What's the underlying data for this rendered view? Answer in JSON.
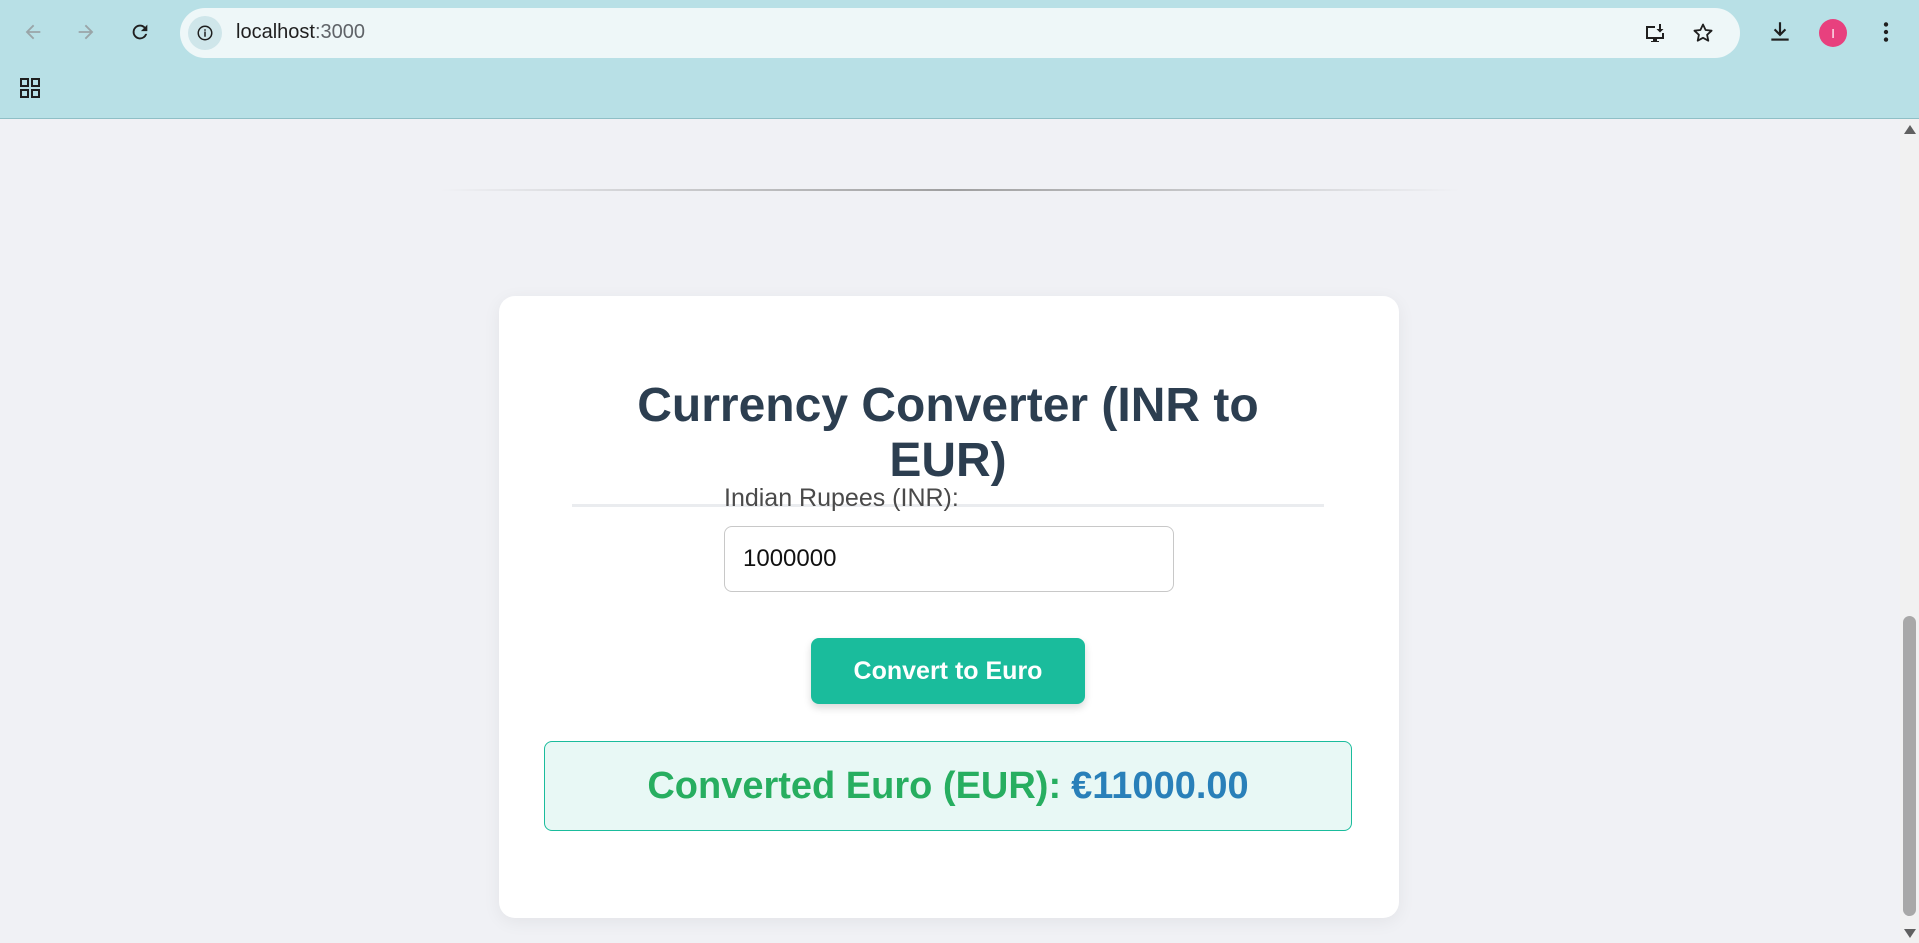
{
  "browser": {
    "url_host": "localhost",
    "url_port": ":3000",
    "icons": {
      "back": "arrow-left-icon",
      "forward": "arrow-right-icon",
      "reload": "reload-icon",
      "site_info": "info-icon",
      "install": "install-app-icon",
      "bookmark": "star-icon",
      "downloads": "download-icon",
      "menu": "kebab-menu-icon",
      "apps": "apps-grid-icon"
    },
    "profile_initial": "I",
    "colors": {
      "toolbar": "#b8e0e6",
      "avatar": "#e8407e"
    }
  },
  "page": {
    "title": "Currency Converter (INR to EUR)",
    "input_label": "Indian Rupees (INR):",
    "input_value": "1000000",
    "convert_button": "Convert to Euro",
    "result_label": "Converted Euro (EUR):",
    "result_value": "€11000.00",
    "colors": {
      "button": "#1abc9c",
      "result_label": "#27ae60",
      "result_value": "#2980b9",
      "title": "#2c3e50"
    }
  }
}
